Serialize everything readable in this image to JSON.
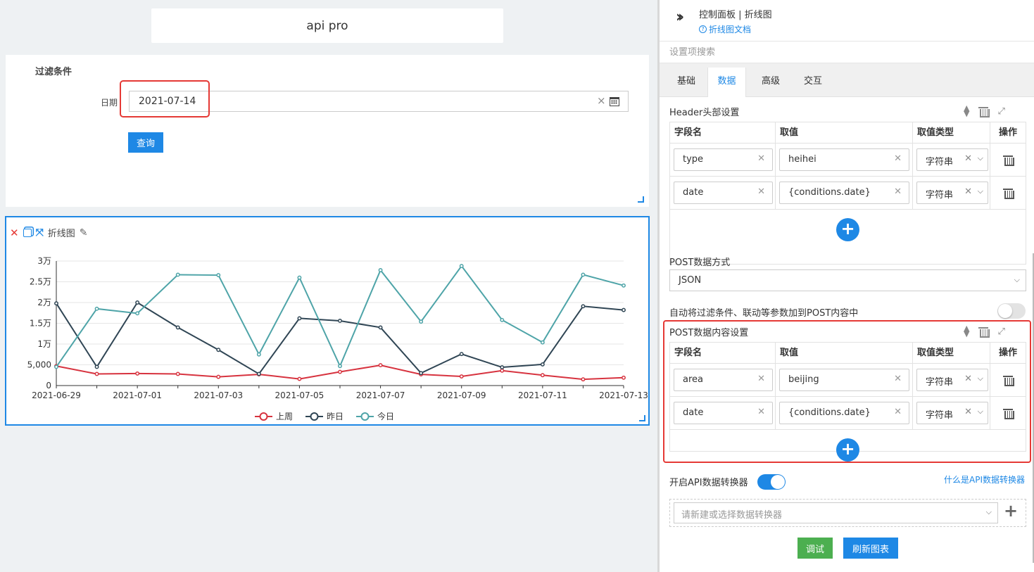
{
  "canvas": {
    "title_card": "api pro",
    "filter": {
      "title": "过滤条件",
      "date_label": "日期",
      "date_value": "2021-07-14",
      "clear_glyph": "×",
      "query_label": "查询"
    },
    "chart_panel": {
      "title": "折线图",
      "toolbar_icons": [
        "close-icon",
        "copy-icon",
        "expand-icon",
        "pencil-icon"
      ]
    }
  },
  "chart_data": {
    "type": "line",
    "categories": [
      "2021-06-29",
      "2021-06-30",
      "2021-07-01",
      "2021-07-02",
      "2021-07-03",
      "2021-07-04",
      "2021-07-05",
      "2021-07-06",
      "2021-07-07",
      "2021-07-08",
      "2021-07-09",
      "2021-07-10",
      "2021-07-11",
      "2021-07-12",
      "2021-07-13"
    ],
    "x_tick_labels": [
      "2021-06-29",
      "2021-07-01",
      "2021-07-03",
      "2021-07-05",
      "2021-07-07",
      "2021-07-09",
      "2021-07-11",
      "2021-07-13"
    ],
    "y_tick_labels": [
      "0",
      "5,000",
      "1万",
      "1.5万",
      "2万",
      "2.5万",
      "3万"
    ],
    "ylim": [
      0,
      30000
    ],
    "grid": true,
    "legend_position": "bottom",
    "series": [
      {
        "name": "上周",
        "color": "#d7333f",
        "values": [
          4700,
          2800,
          2900,
          2800,
          2100,
          2700,
          1600,
          3300,
          4900,
          2700,
          2200,
          3600,
          2500,
          1500,
          1900
        ]
      },
      {
        "name": "昨日",
        "color": "#2f4554",
        "values": [
          19800,
          4500,
          20000,
          14000,
          8600,
          2800,
          16200,
          15600,
          14000,
          3000,
          7600,
          4400,
          5100,
          19100,
          18200
        ]
      },
      {
        "name": "今日",
        "color": "#4ea4a8",
        "values": [
          4500,
          18500,
          17400,
          26700,
          26600,
          7500,
          26000,
          4700,
          27800,
          15400,
          28800,
          15800,
          10400,
          26700,
          24100
        ]
      }
    ]
  },
  "panel": {
    "title": "控制面板 | 折线图",
    "doc_link": "折线图文档",
    "search_placeholder": "设置项搜索",
    "tabs": [
      {
        "label": "基础",
        "active": false
      },
      {
        "label": "数据",
        "active": true
      },
      {
        "label": "高级",
        "active": false
      },
      {
        "label": "交互",
        "active": false
      }
    ],
    "header_section": {
      "title": "Header头部设置",
      "columns": [
        "字段名",
        "取值",
        "取值类型",
        "操作"
      ],
      "rows": [
        {
          "field": "type",
          "value": "heihei",
          "type": "字符串"
        },
        {
          "field": "date",
          "value": "{conditions.date}",
          "type": "字符串"
        }
      ]
    },
    "post_method": {
      "label": "POST数据方式",
      "value": "JSON"
    },
    "auto_add": {
      "label": "自动将过滤条件、联动等参数加到POST内容中",
      "enabled": false
    },
    "post_body_section": {
      "title": "POST数据内容设置",
      "columns": [
        "字段名",
        "取值",
        "取值类型",
        "操作"
      ],
      "rows": [
        {
          "field": "area",
          "value": "beijing",
          "type": "字符串"
        },
        {
          "field": "date",
          "value": "{conditions.date}",
          "type": "字符串"
        }
      ]
    },
    "converter": {
      "label": "开启API数据转换器",
      "enabled": true,
      "help_link": "什么是API数据转换器",
      "placeholder": "请新建或选择数据转换器"
    },
    "buttons": {
      "debug": "调试",
      "refresh": "刷新图表"
    },
    "accent_color": "#1e88e5"
  }
}
